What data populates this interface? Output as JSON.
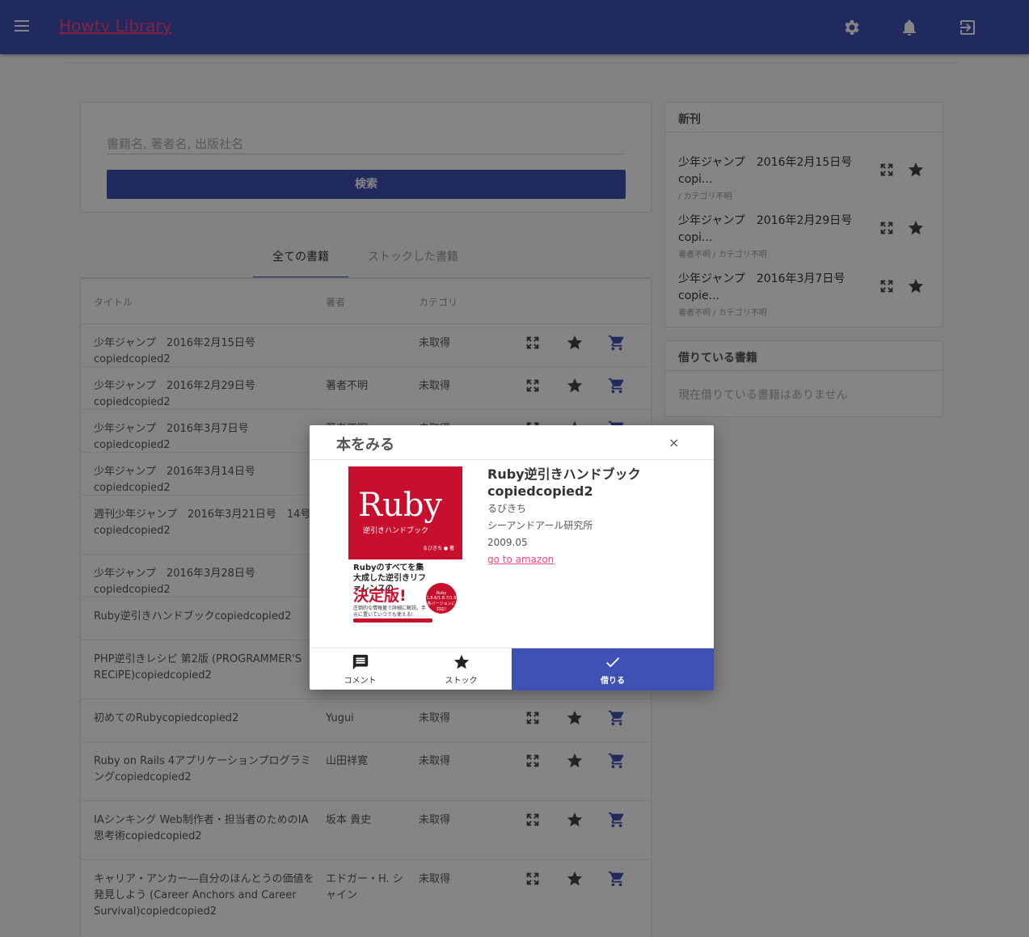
{
  "app": {
    "title": "Howtv Library"
  },
  "search": {
    "placeholder": "書籍名, 著者名, 出版社名",
    "button_label": "検索"
  },
  "tabs": [
    {
      "label": "全ての書籍"
    },
    {
      "label": "ストックした書籍"
    }
  ],
  "table": {
    "headers": {
      "title": "タイトル",
      "author": "著者",
      "category": "カテゴリ"
    },
    "rows": [
      {
        "title": "少年ジャンプ　2016年2月15日号copiedcopied2",
        "author": "",
        "category": "未取得"
      },
      {
        "title": "少年ジャンプ　2016年2月29日号copiedcopied2",
        "author": "著者不明",
        "category": "未取得"
      },
      {
        "title": "少年ジャンプ　2016年3月7日号copiedcopied2",
        "author": "著者不明",
        "category": "未取得"
      },
      {
        "title": "少年ジャンプ　2016年3月14日号copiedcopied2",
        "author": "",
        "category": ""
      },
      {
        "title": "週刊少年ジャンプ　2016年3月21日号　14号copiedcopied2",
        "author": "",
        "category": ""
      },
      {
        "title": "少年ジャンプ　2016年3月28日号copiedcopied2",
        "author": "",
        "category": ""
      },
      {
        "title": "Ruby逆引きハンドブックcopiedcopied2",
        "author": "",
        "category": ""
      },
      {
        "title": "PHP逆引きレシピ 第2版 (PROGRAMMER'S RECiPE)copiedcopied2",
        "author": "",
        "category": ""
      },
      {
        "title": "初めてのRubycopiedcopied2",
        "author": "Yugui",
        "category": "未取得"
      },
      {
        "title": "Ruby on Rails 4アプリケーションプログラミングcopiedcopied2",
        "author": "山田祥寛",
        "category": "未取得"
      },
      {
        "title": "IAシンキング Web制作者・担当者のためのIA思考術copiedcopied2",
        "author": "坂本 貴史",
        "category": "未取得"
      },
      {
        "title": "キャリア・アンカー―自分のほんとうの価値を発見しよう (Career Anchors and Career Survival)copiedcopied2",
        "author": "エドガー・H. シャイン",
        "category": "未取得"
      }
    ]
  },
  "new_books": {
    "heading": "新刊",
    "items": [
      {
        "title": "少年ジャンプ　2016年2月15日号 copi...",
        "sub": "/ カテゴリ不明"
      },
      {
        "title": "少年ジャンプ　2016年2月29日号 copi...",
        "sub": "著者不明 / カテゴリ不明"
      },
      {
        "title": "少年ジャンプ　2016年3月7日号 copie...",
        "sub": "著者不明 / カテゴリ不明"
      }
    ]
  },
  "borrowed": {
    "heading": "借りている書籍",
    "empty": "現在借りている書籍はありません"
  },
  "modal": {
    "title": "本をみる",
    "close": "×",
    "book": {
      "title": "Ruby逆引きハンドブックcopiedcopied2",
      "author": "るびきち",
      "publisher": "シーアンドアール研究所",
      "date": "2009.05",
      "link": "go to amazon"
    },
    "cover": {
      "brand": "Ruby",
      "subtitle": "逆引きハンドブック",
      "author": "るびきち ● 著",
      "tagline": "Rubyのすべてを集大成した逆引きリファレンスの",
      "headline": "決定版!",
      "badge": "Ruby 1.8.6/1.8.7/1.9 各バージョンに対応!",
      "fine": "圧倒的な情報量で詳細に解説。手元に置いていつでも使える!"
    },
    "actions": {
      "comment": "コメント",
      "stock": "ストック",
      "borrow": "借りる"
    }
  },
  "colors": {
    "primary": "#3f51b5",
    "accent": "#ff4081",
    "cover_red": "#c8102e"
  }
}
